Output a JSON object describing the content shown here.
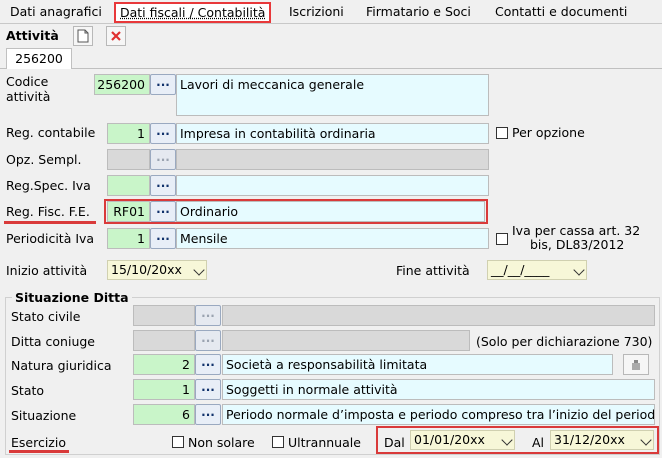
{
  "tabs": [
    {
      "label": "Dati anagrafici"
    },
    {
      "label": "Dati fiscali / Contabilità"
    },
    {
      "label": "Iscrizioni"
    },
    {
      "label": "Firmatario e Soci"
    },
    {
      "label": "Contatti e documenti"
    }
  ],
  "toolbar": {
    "title": "Attività"
  },
  "subtab": {
    "label": "256200"
  },
  "fields": {
    "codice_attivita": {
      "label": "Codice attività",
      "code": "256200",
      "desc": "Lavori di meccanica generale"
    },
    "reg_contabile": {
      "label": "Reg. contabile",
      "code": "1",
      "desc": "Impresa  in contabilità ordinaria"
    },
    "per_opzione": {
      "label": "Per opzione"
    },
    "opz_sempl": {
      "label": "Opz. Sempl.",
      "code": "",
      "desc": ""
    },
    "reg_spec_iva": {
      "label": "Reg.Spec. Iva",
      "code": "",
      "desc": ""
    },
    "reg_fisc_fe": {
      "label": "Reg. Fisc. F.E.",
      "code": "RF01",
      "desc": "Ordinario"
    },
    "periodicita_iva": {
      "label": "Periodicità Iva",
      "code": "1",
      "desc": "Mensile"
    },
    "iva_per_cassa": {
      "label_line1": "Iva per cassa art. 32",
      "label_line2": "bis, DL83/2012"
    },
    "inizio_attivita": {
      "label": "Inizio attività",
      "value": "15/10/20xx"
    },
    "fine_attivita": {
      "label": "Fine attività",
      "value": "__/__/____"
    }
  },
  "situazione": {
    "title": "Situazione Ditta",
    "stato_civile": {
      "label": "Stato civile",
      "code": "",
      "desc": ""
    },
    "ditta_coniuge": {
      "label": "Ditta coniuge",
      "code": "",
      "note": "(Solo per dichiarazione 730)"
    },
    "natura_giuridica": {
      "label": "Natura giuridica",
      "code": "2",
      "desc": "Società a responsabilità limitata"
    },
    "stato": {
      "label": "Stato",
      "code": "1",
      "desc": "Soggetti in normale attività"
    },
    "situazione": {
      "label": "Situazione",
      "code": "6",
      "desc": "Periodo normale d’imposta e periodo compreso tra l’inizio del period"
    }
  },
  "esercizio": {
    "label": "Esercizio",
    "non_solare": "Non solare",
    "ultrannuale": "Ultrannuale",
    "dal_label": "Dal",
    "dal_value": "01/01/20xx",
    "al_label": "Al",
    "al_value": "31/12/20xx"
  },
  "colors": {
    "highlight": "#d93a3a",
    "code_bg": "#c9f5c9",
    "desc_bg": "#e6fbff",
    "date_bg": "#f7f7d8"
  }
}
